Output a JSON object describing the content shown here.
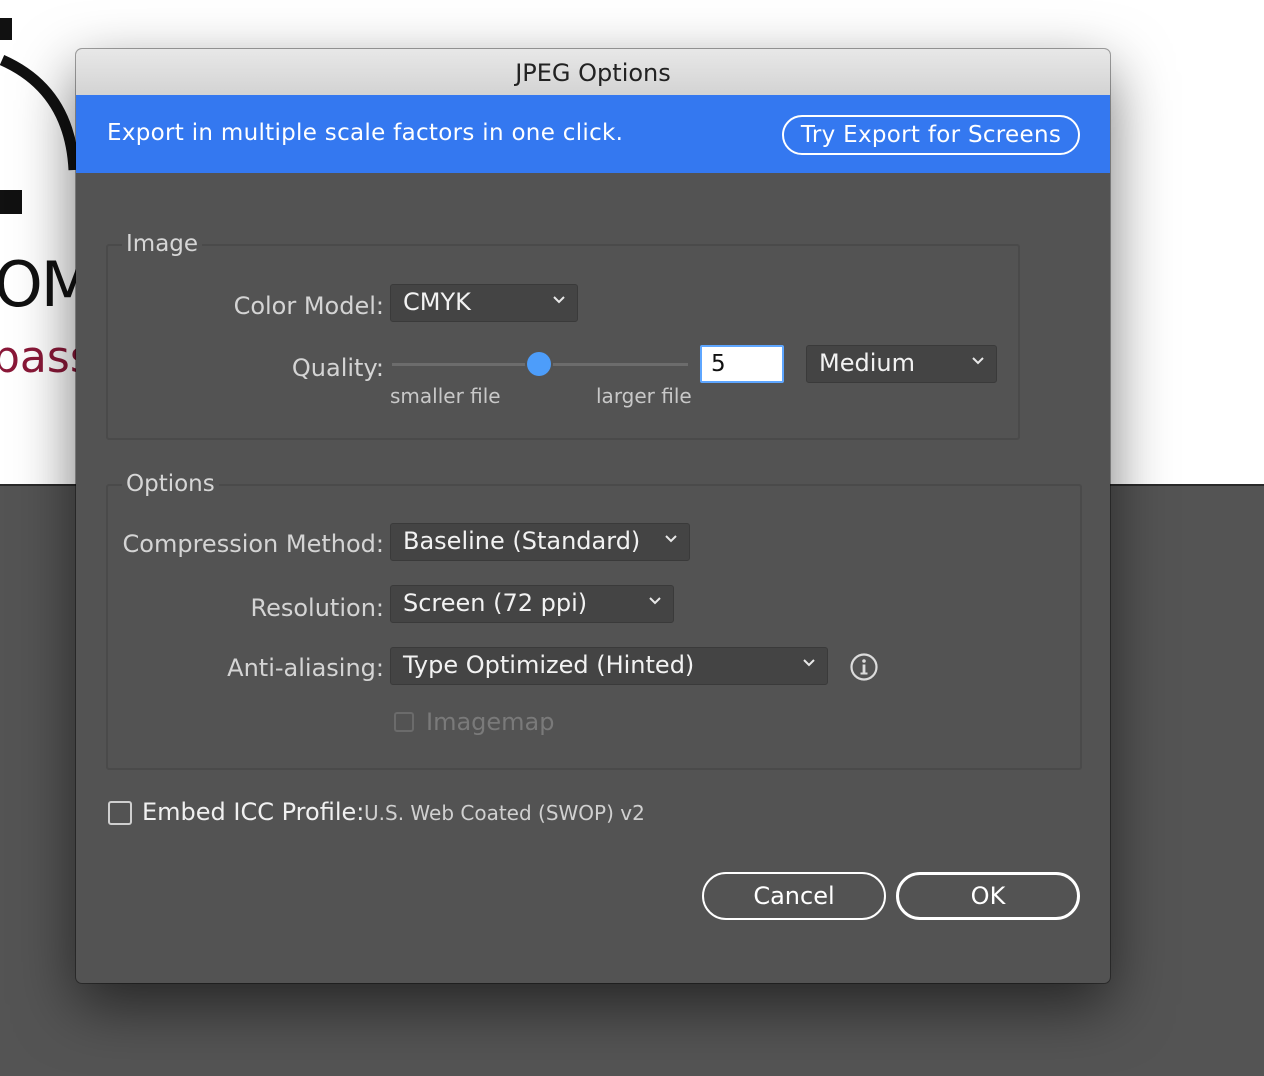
{
  "background": {
    "letters": "OM",
    "word": "pass"
  },
  "dialog": {
    "title": "JPEG Options",
    "promo": {
      "text": "Export in multiple scale factors in one click.",
      "button": "Try Export for Screens",
      "color": "#3478f0"
    },
    "image_group": {
      "title": "Image",
      "color_model_label": "Color Model:",
      "color_model_value": "CMYK",
      "quality_label": "Quality:",
      "quality_value": "5",
      "quality_preset": "Medium",
      "slider_min_caption": "smaller file",
      "slider_max_caption": "larger file"
    },
    "options_group": {
      "title": "Options",
      "compression_label": "Compression Method:",
      "compression_value": "Baseline (Standard)",
      "resolution_label": "Resolution:",
      "resolution_value": "Screen (72 ppi)",
      "antialias_label": "Anti-aliasing:",
      "antialias_value": "Type Optimized (Hinted)",
      "imagemap_label": "Imagemap",
      "imagemap_checked": false,
      "imagemap_enabled": false
    },
    "icc": {
      "label": "Embed ICC Profile:",
      "profile": "U.S. Web Coated (SWOP) v2",
      "checked": false
    },
    "buttons": {
      "cancel": "Cancel",
      "ok": "OK"
    }
  }
}
